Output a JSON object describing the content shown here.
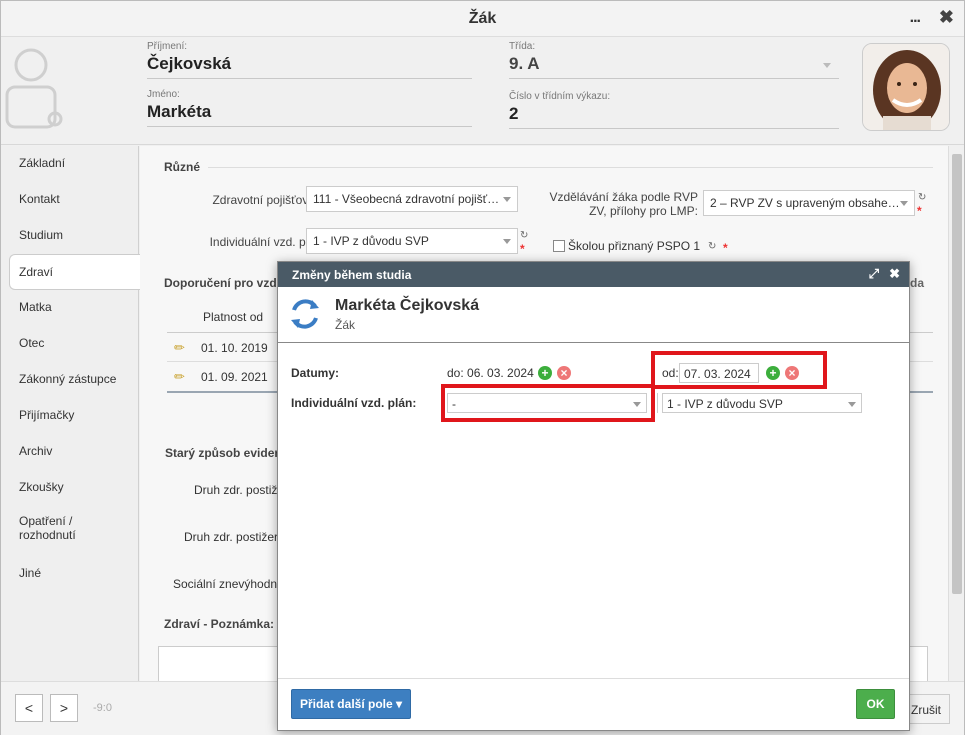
{
  "window": {
    "title": "Žák",
    "more_label": "...",
    "close_label": "✖"
  },
  "header": {
    "surname_label": "Příjmení:",
    "surname_value": "Čejkovská",
    "name_label": "Jméno:",
    "name_value": "Markéta",
    "class_label": "Třída:",
    "class_value": "9. A",
    "number_label": "Číslo v třídním výkazu:",
    "number_value": "2"
  },
  "sidebar": {
    "items": [
      {
        "label": "Základní"
      },
      {
        "label": "Kontakt"
      },
      {
        "label": "Studium"
      },
      {
        "label": "Zdraví"
      },
      {
        "label": "Matka"
      },
      {
        "label": "Otec"
      },
      {
        "label": "Zákonný zástupce"
      },
      {
        "label": "Přijímačky"
      },
      {
        "label": "Archiv"
      },
      {
        "label": "Zkoušky"
      },
      {
        "label": "Opatření / rozhodnutí"
      },
      {
        "label": "Jiné"
      }
    ],
    "active_index": 3
  },
  "main": {
    "section_ruzne": "Různé",
    "insurance_label": "Zdravotní pojišťovna:",
    "insurance_value": "111 - Všeobecná zdravotní pojišť…",
    "ivp_label": "Individuální vzd. plán:",
    "ivp_value": "1 - IVP z důvodu SVP",
    "rvp_label_line1": "Vzdělávání žáka podle RVP",
    "rvp_label_line2": "ZV, přílohy pro LMP:",
    "rvp_value": "2 – RVP ZV s upraveným obsahe…",
    "pspo_label": "Školou přiznaný PSPO 1",
    "section_doporuceni": "Doporučení pro vzd",
    "right_clip": "da",
    "table_header_validity": "Platnost od",
    "table_rows": [
      {
        "date": "01. 10. 2019"
      },
      {
        "date": "01. 09. 2021"
      }
    ],
    "section_stary": "Starý způsob evider",
    "druh1_label": "Druh zdr. postiž",
    "druh2_label": "Druh zdr. postižer",
    "socialni_label": "Sociální znevýhodn",
    "section_poznamka": "Zdraví - Poznámka:"
  },
  "footer": {
    "prev_label": "<",
    "next_label": ">",
    "position_text": "-9:0",
    "cancel_label": "Zrušit"
  },
  "modal": {
    "title": "Změny během studia",
    "person_name": "Markéta Čejkovská",
    "person_role": "Žák",
    "dates_label": "Datumy:",
    "to_text": "do: 06. 03. 2024",
    "from_label": "od:",
    "from_value": "07. 03. 2024",
    "ivp_label": "Individuální vzd. plán:",
    "ivp_old_value": "-",
    "ivp_new_value": "1 - IVP z důvodu SVP",
    "add_field_label": "Přidat další pole ▾",
    "ok_label": "OK"
  },
  "colors": {
    "modal_bar": "#4a5a66",
    "highlight_red": "#e0161b",
    "ok_green": "#4cae4c",
    "add_blue": "#3d7fc1"
  }
}
